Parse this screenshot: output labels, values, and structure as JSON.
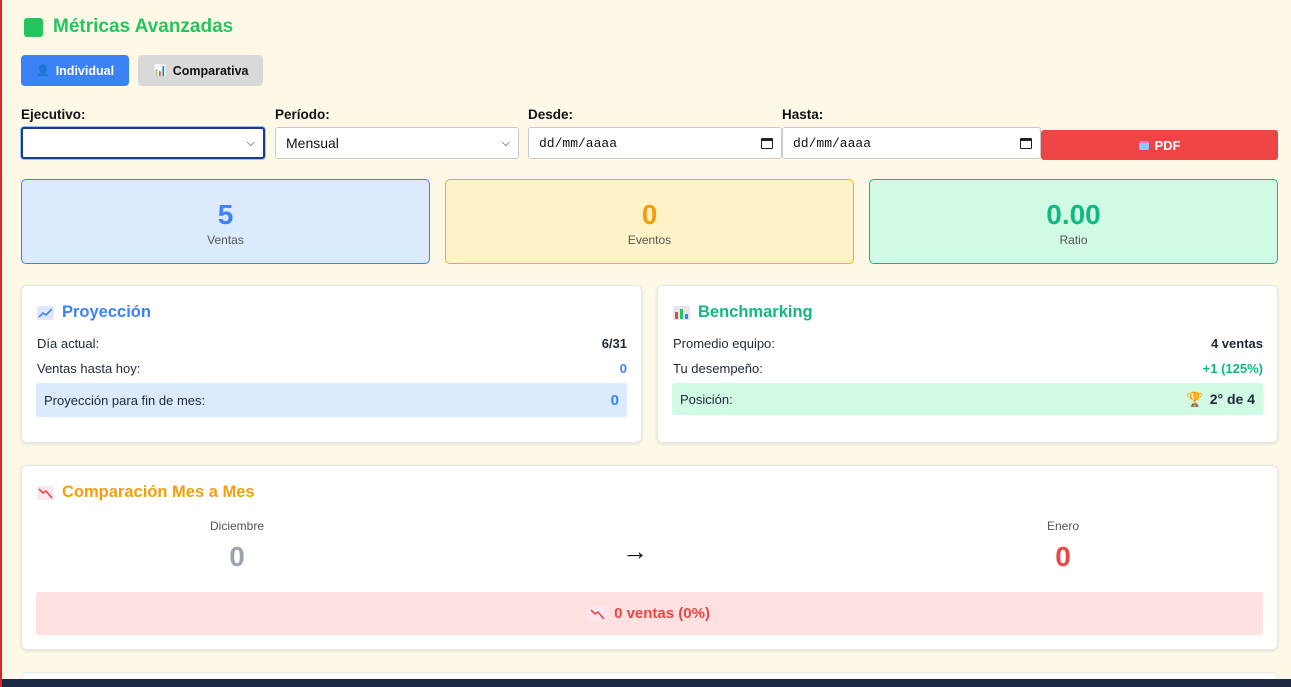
{
  "header": {
    "title": "Métricas Avanzadas",
    "icon": "green-square-icon",
    "accent": "#22c55e"
  },
  "tabs": [
    {
      "label": "Individual",
      "icon": "user-icon",
      "active": true
    },
    {
      "label": "Comparativa",
      "icon": "bar-chart-icon",
      "active": false
    }
  ],
  "filters": {
    "ejecutivo": {
      "label": "Ejecutivo:",
      "value": ""
    },
    "periodo": {
      "label": "Período:",
      "value": "Mensual"
    },
    "desde": {
      "label": "Desde:",
      "placeholder": "dd/mm/aaaa"
    },
    "hasta": {
      "label": "Hasta:",
      "placeholder": "dd/mm/aaaa"
    },
    "pdf_label": "PDF"
  },
  "stats": [
    {
      "value": "5",
      "label": "Ventas",
      "color": "#3b82f6"
    },
    {
      "value": "0",
      "label": "Eventos",
      "color": "#f59e0b"
    },
    {
      "value": "0.00",
      "label": "Ratio",
      "color": "#10b981"
    }
  ],
  "proyeccion": {
    "title": "Proyección",
    "dia_label": "Día actual:",
    "dia_value": "6/31",
    "ventas_label": "Ventas hasta hoy:",
    "ventas_value": "0",
    "proy_label": "Proyección para fin de mes:",
    "proy_value": "0"
  },
  "benchmarking": {
    "title": "Benchmarking",
    "promedio_label": "Promedio equipo:",
    "promedio_value": "4 ventas",
    "desempeno_label": "Tu desempeño:",
    "desempeno_value": "+1 (125%)",
    "posicion_label": "Posición:",
    "posicion_value": "2° de 4"
  },
  "comparacion": {
    "title": "Comparación Mes a Mes",
    "prev_month": "Diciembre",
    "prev_value": "0",
    "arrow": "→",
    "curr_month": "Enero",
    "curr_value": "0",
    "summary": "0 ventas (0%)"
  }
}
